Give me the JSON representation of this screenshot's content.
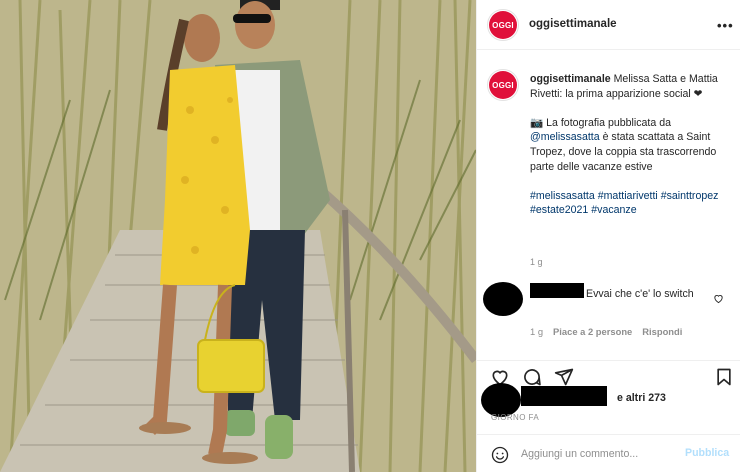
{
  "account": {
    "username": "oggisettimanale",
    "avatar_text": "OGGI",
    "brand_color": "#e0103a"
  },
  "caption": {
    "username": "oggisettimanale",
    "line1": "Melissa Satta e Mattia Rivetti: la prima apparizione social ❤",
    "line2_prefix": "📷 La fotografia pubblicata da ",
    "mention": "@melissasatta",
    "line2_suffix": " è stata scattata a Saint Tropez, dove la coppia sta trascorrendo parte delle vacanze estive",
    "hashtags": "#melissasatta #mattiarivetti #sainttropez #estate2021 #vacanze",
    "time": "1 g"
  },
  "comment": {
    "text": "Evvai che c'e' lo switch",
    "time": "1 g",
    "likes": "Piace a 2 persone",
    "reply": "Rispondi"
  },
  "post": {
    "likes_suffix": "e altri 273",
    "ago": "GIORNO FA"
  },
  "input": {
    "placeholder": "Aggiungi un commento...",
    "publish": "Pubblica"
  },
  "colors": {
    "link": "#00376b",
    "muted": "#8e8e8e",
    "publish_disabled": "#b2dffc"
  }
}
